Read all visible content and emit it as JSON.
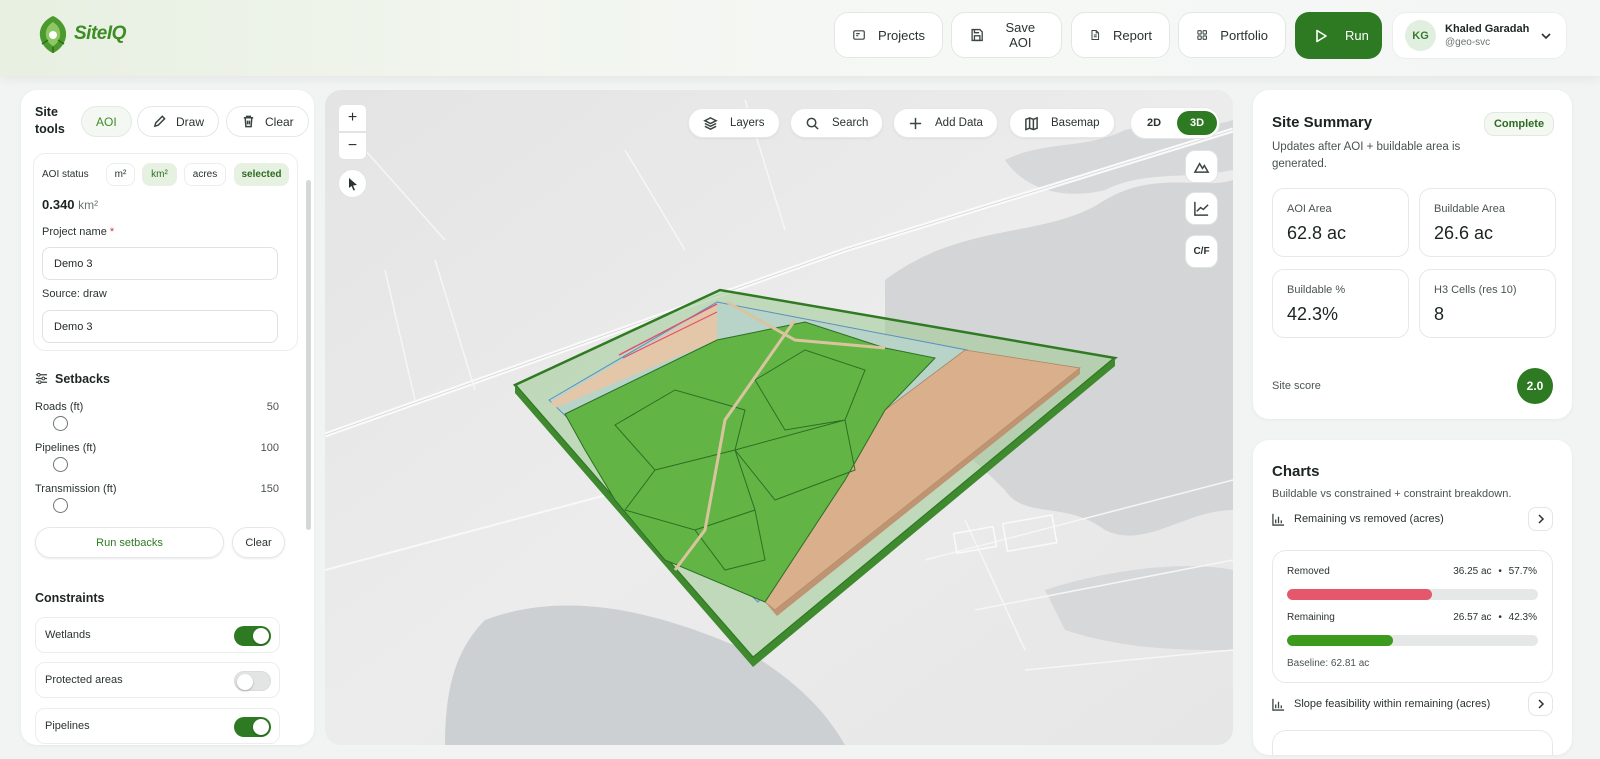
{
  "brand": {
    "name": "SiteIQ",
    "accent": "#2d7a22",
    "logo_color": "#3e8c24"
  },
  "header": {
    "nav": [
      {
        "label": "Projects",
        "icon": "folder-icon"
      },
      {
        "label": "Save AOI",
        "icon": "save-icon"
      },
      {
        "label": "Report",
        "icon": "document-icon"
      },
      {
        "label": "Portfolio",
        "icon": "grid-icon"
      }
    ],
    "run_label": "Run",
    "user": {
      "initials": "KG",
      "name": "Khaled Garadah",
      "handle": "@geo-svc"
    }
  },
  "site_tools": {
    "title": "Site tools",
    "tools": [
      "AOI",
      "Draw",
      "Clear"
    ],
    "aoi_status_label": "AOI status",
    "units": [
      "m²",
      "km²",
      "acres"
    ],
    "active_unit": "km²",
    "selected_badge": "selected",
    "area_value": "0.340",
    "area_unit": "km²",
    "project_name_label": "Project name",
    "required_mark": "*",
    "project_name_value": "Demo 3",
    "source_label": "Source: draw",
    "source_value": "Demo 3"
  },
  "setbacks": {
    "title": "Setbacks",
    "items": [
      {
        "label": "Roads (ft)",
        "value": "50"
      },
      {
        "label": "Pipelines (ft)",
        "value": "100"
      },
      {
        "label": "Transmission (ft)",
        "value": "150"
      }
    ],
    "run_label": "Run setbacks",
    "clear_label": "Clear"
  },
  "constraints": {
    "title": "Constraints",
    "items": [
      {
        "label": "Wetlands",
        "enabled": true
      },
      {
        "label": "Protected areas",
        "enabled": false
      },
      {
        "label": "Pipelines",
        "enabled": true
      }
    ]
  },
  "map": {
    "toolbar": [
      "Layers",
      "Search",
      "Add Data",
      "Basemap"
    ],
    "view_modes": [
      "2D",
      "3D"
    ],
    "active_view": "3D",
    "zoom_in": "+",
    "zoom_out": "−",
    "cf_label": "C/F"
  },
  "summary": {
    "title": "Site Summary",
    "status": "Complete",
    "subtitle": "Updates after AOI + buildable area is generated.",
    "stats": [
      {
        "label": "AOI Area",
        "value": "62.8 ac"
      },
      {
        "label": "Buildable Area",
        "value": "26.6 ac"
      },
      {
        "label": "Buildable %",
        "value": "42.3%"
      },
      {
        "label": "H3 Cells (res 10)",
        "value": "8"
      }
    ],
    "score_label": "Site score",
    "score_value": "2.0"
  },
  "charts": {
    "title": "Charts",
    "subtitle": "Buildable vs constrained + constraint breakdown.",
    "chart1_title": "Remaining vs removed (acres)",
    "removed": {
      "label": "Removed",
      "value_text": "36.25 ac",
      "pct_text": "57.7%",
      "fraction": 0.577,
      "color": "#e5576a"
    },
    "remaining": {
      "label": "Remaining",
      "value_text": "26.57 ac",
      "pct_text": "42.3%",
      "fraction": 0.423,
      "color": "#3c9a1c"
    },
    "separator": "•",
    "baseline": "Baseline: 62.81 ac",
    "chart2_title": "Slope feasibility within remaining (acres)"
  }
}
